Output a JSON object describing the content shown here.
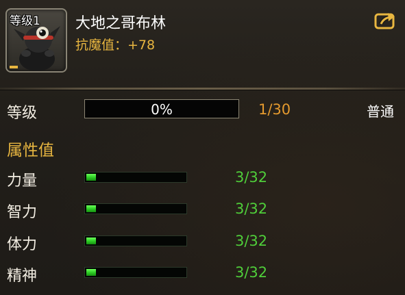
{
  "header": {
    "level_badge": "等级1",
    "name": "大地之哥布林",
    "stat_text": "抗魔值：+78",
    "share_icon": "share-arrow-icon"
  },
  "level_row": {
    "label": "等级",
    "progress_text": "0%",
    "progress": 0.0,
    "count": "1/30",
    "quality": "普通"
  },
  "attributes": {
    "title": "属性值",
    "items": [
      {
        "label": "力量",
        "value": "3/32",
        "progress": 0.09375
      },
      {
        "label": "智力",
        "value": "3/32",
        "progress": 0.09375
      },
      {
        "label": "体力",
        "value": "3/32",
        "progress": 0.09375
      },
      {
        "label": "精神",
        "value": "3/32",
        "progress": 0.09375
      }
    ]
  },
  "colors": {
    "gold": "#e8b640",
    "orange": "#e59a2e",
    "green": "#4fce3a",
    "white": "#ffffff"
  }
}
